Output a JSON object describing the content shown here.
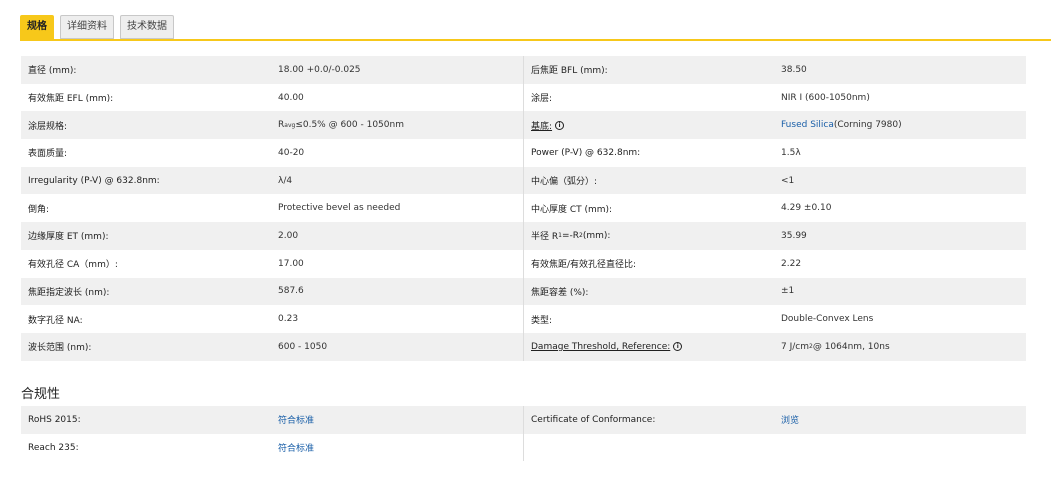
{
  "tabs": [
    {
      "label": "规格"
    },
    {
      "label": "详细资料"
    },
    {
      "label": "技术数据"
    }
  ],
  "specs": [
    {
      "l1": "直径 (mm):",
      "v1": "18.00 +0.0/-0.025",
      "l2": "后焦距 BFL (mm):",
      "v2": "38.50"
    },
    {
      "l1": "有效焦距 EFL (mm):",
      "v1": "40.00",
      "l2": "涂层:",
      "v2": "NIR I (600-1050nm)"
    },
    {
      "l1": "涂层规格:",
      "v1_pre": "R",
      "v1_sub": "avg",
      "v1_post": " ≤0.5% @ 600 - 1050nm",
      "l2": "基底:",
      "v2_link": "Fused Silica",
      "v2_post": " (Corning 7980)"
    },
    {
      "l1": "表面质量:",
      "v1": "40-20",
      "l2": "Power (P-V) @ 632.8nm:",
      "v2": "1.5λ"
    },
    {
      "l1": "Irregularity (P-V) @ 632.8nm:",
      "v1": "λ/4",
      "l2": "中心偏（弧分）:",
      "v2": "<1"
    },
    {
      "l1": "倒角:",
      "v1": "Protective bevel as needed",
      "l2": "中心厚度 CT (mm):",
      "v2": "4.29 ±0.10"
    },
    {
      "l1": "边缘厚度 ET (mm):",
      "v1": "2.00",
      "l2_pre": "半径 R",
      "l2_sub1": "1",
      "l2_mid": "=-R",
      "l2_sub2": "2",
      "l2_post": " (mm):",
      "v2": "35.99"
    },
    {
      "l1": "有效孔径 CA（mm）:",
      "v1": "17.00",
      "l2": "有效焦距/有效孔径直径比:",
      "v2": "2.22"
    },
    {
      "l1": "焦距指定波长 (nm):",
      "v1": "587.6",
      "l2": "焦距容差 (%):",
      "v2": "±1"
    },
    {
      "l1": "数字孔径 NA:",
      "v1": "0.23",
      "l2": "类型:",
      "v2": "Double-Convex Lens"
    },
    {
      "l1": "波长范围 (nm):",
      "v1": "600 - 1050",
      "l2": "Damage Threshold, Reference:",
      "v2_pre": "7 J/cm",
      "v2_sup": "2",
      "v2_post": " @ 1064nm, 10ns"
    }
  ],
  "info_glyph": "i",
  "compliance": {
    "title": "合规性",
    "rows": [
      {
        "l1": "RoHS 2015:",
        "v1": "符合标准",
        "l2": "Certificate of Conformance:",
        "v2": "浏览"
      },
      {
        "l1": "Reach 235:",
        "v1": "符合标准"
      }
    ]
  },
  "colors": {
    "accent": "#f7c81a",
    "link": "#1a5fa8",
    "stripe": "#f0f0f0"
  }
}
